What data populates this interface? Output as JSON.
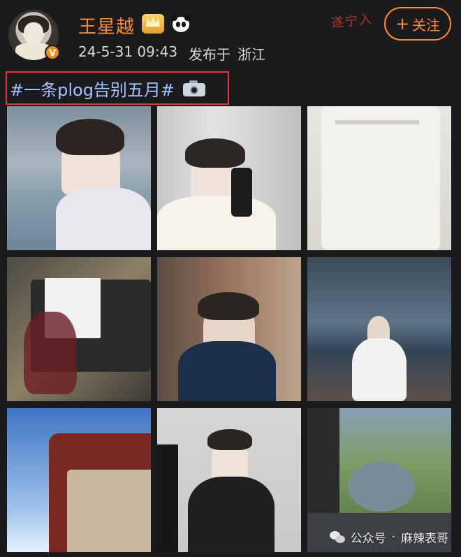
{
  "header": {
    "username": "王星越",
    "timestamp": "24-5-31 09:43",
    "location_label": "发布于",
    "location": "浙江",
    "verified_badge": "V",
    "badges": [
      "crown-icon",
      "panda-icon"
    ],
    "follow_button": {
      "plus": "+",
      "label": "关注"
    },
    "background_text": "遂宁入"
  },
  "post": {
    "hashtag": "#一条plog告别五月#",
    "hashtag_emoji": "camera-icon"
  },
  "photos": [
    {
      "name": "photo-1"
    },
    {
      "name": "photo-2"
    },
    {
      "name": "photo-3"
    },
    {
      "name": "photo-4"
    },
    {
      "name": "photo-5"
    },
    {
      "name": "photo-6"
    },
    {
      "name": "photo-7"
    },
    {
      "name": "photo-8"
    },
    {
      "name": "photo-9"
    }
  ],
  "footer_watermark": {
    "prefix": "公众号",
    "separator": "·",
    "name": "麻辣表哥"
  },
  "colors": {
    "accent": "#ff8a2b",
    "hashtag": "#9fc3ff",
    "highlight_box": "#e23a3a",
    "background": "#1b1b1d"
  }
}
